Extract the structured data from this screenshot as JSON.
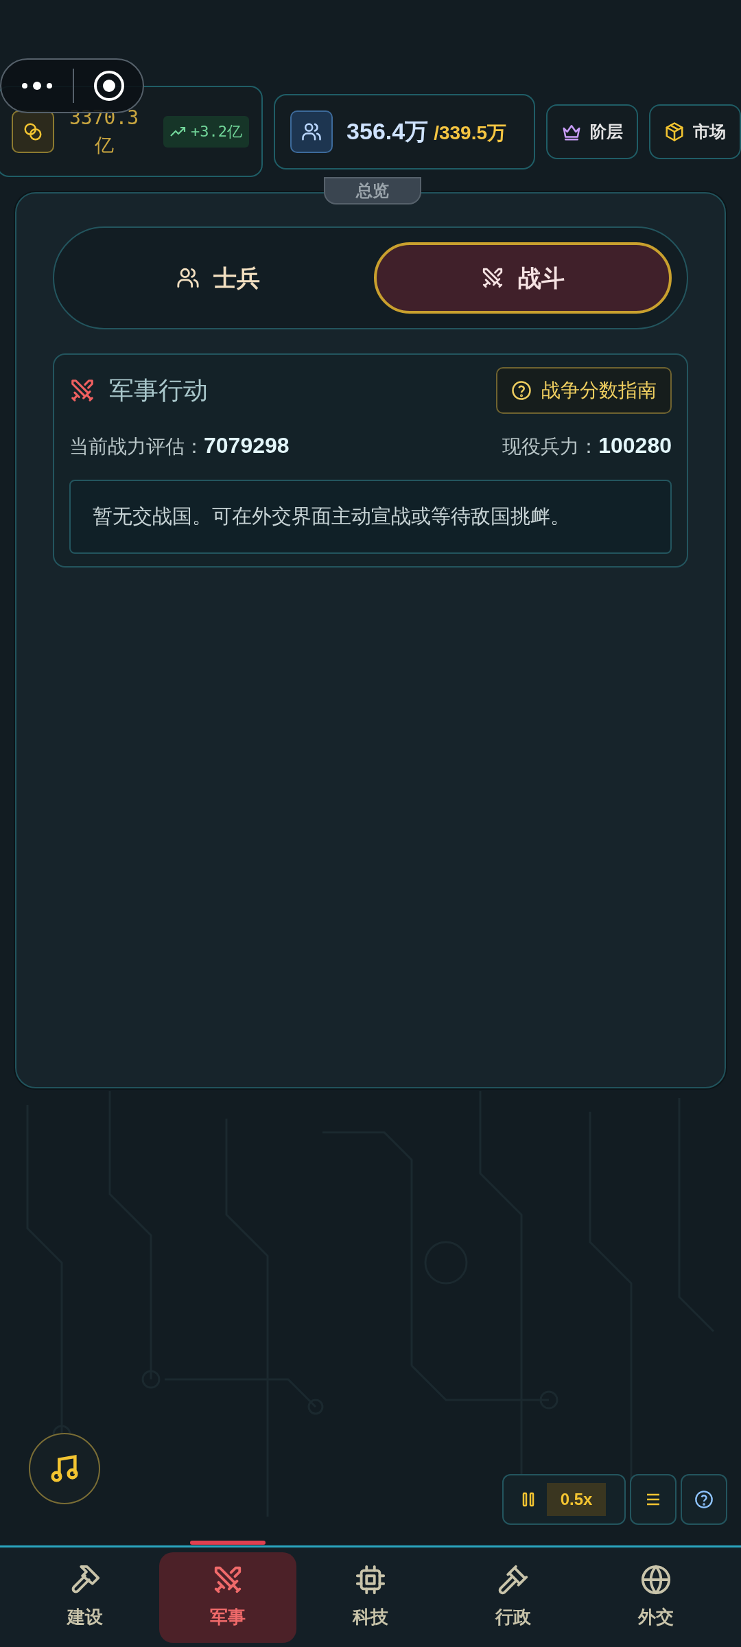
{
  "resources": {
    "gold": {
      "value": "3370.3",
      "unit": "亿",
      "change": "+3.2亿"
    },
    "population": {
      "current": "356.4万",
      "capacity": "/339.5万"
    }
  },
  "top_buttons": [
    {
      "label": "阶层",
      "kind": "crown"
    },
    {
      "label": "市场",
      "kind": "box"
    }
  ],
  "overview_tab": "总览",
  "tabs": [
    {
      "label": "士兵",
      "selected": false,
      "kind": "soldiers"
    },
    {
      "label": "战斗",
      "selected": true,
      "kind": "battle"
    }
  ],
  "military": {
    "title": "军事行动",
    "guide_button": "战争分数指南",
    "stats": [
      {
        "label": "当前战力评估：",
        "value": "7079298"
      },
      {
        "label": "现役兵力：",
        "value": "100280"
      }
    ],
    "notice": "暂无交战国。可在外交界面主动宣战或等待敌国挑衅。"
  },
  "speed": "0.5x",
  "nav": [
    {
      "label": "建设",
      "selected": false,
      "kind": "hammer"
    },
    {
      "label": "军事",
      "selected": true,
      "kind": "swords"
    },
    {
      "label": "科技",
      "selected": false,
      "kind": "chip"
    },
    {
      "label": "行政",
      "selected": false,
      "kind": "gavel"
    },
    {
      "label": "外交",
      "selected": false,
      "kind": "globe"
    }
  ]
}
